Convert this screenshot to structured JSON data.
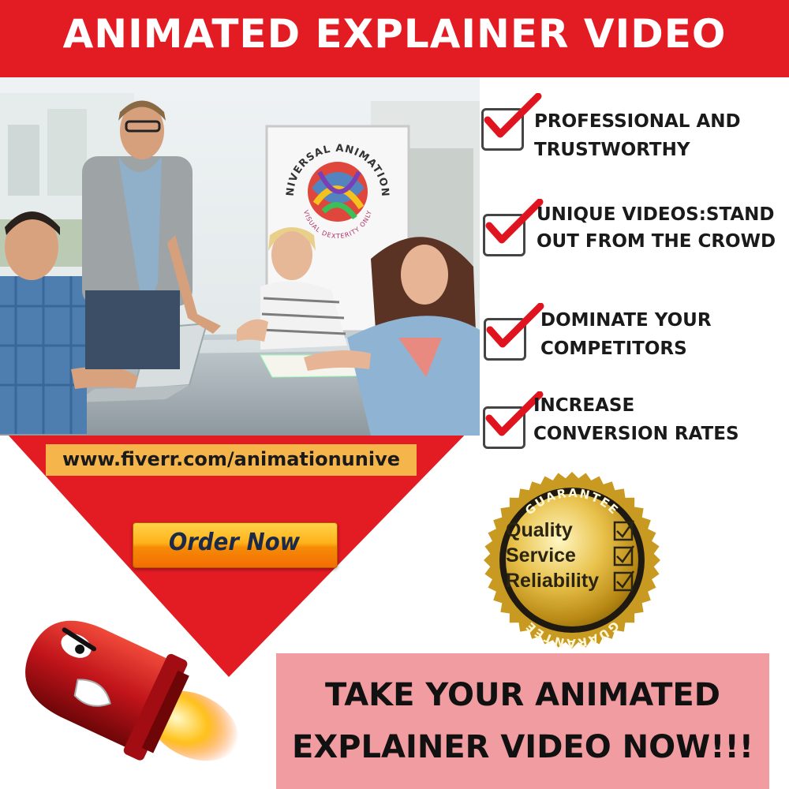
{
  "header": {
    "title": "ANIMATED EXPLAINER VIDEO"
  },
  "photo": {
    "board_brand": "UNIVERSAL ANIMATIONS",
    "board_tagline": "VISUAL DEXTERITY ONLY"
  },
  "features": [
    {
      "line1": "PROFESSIONAL AND",
      "line2": "TRUSTWORTHY"
    },
    {
      "line1": "UNIQUE VIDEOS:STAND",
      "line2": "OUT FROM THE CROWD"
    },
    {
      "line1": "DOMINATE YOUR",
      "line2": "COMPETITORS"
    },
    {
      "line1": "INCREASE",
      "line2": "CONVERSION RATES"
    }
  ],
  "url": "www.fiverr.com/animationunive",
  "order_button": "Order Now",
  "seal": {
    "top_text": "GUARANTEE",
    "bottom_text": "GUARANTEE",
    "items": [
      "Quality",
      "Service",
      "Reliability"
    ]
  },
  "cta": {
    "line1": "TAKE YOUR ANIMATED",
    "line2": "EXPLAINER VIDEO NOW!!!"
  },
  "colors": {
    "brand_red": "#e31b23",
    "url_bg": "#f6b54a",
    "cta_bg": "#f19ca0",
    "check_red": "#e0141e"
  },
  "icons": [
    "check-icon",
    "rocket-bullet-icon",
    "guarantee-seal-icon"
  ]
}
